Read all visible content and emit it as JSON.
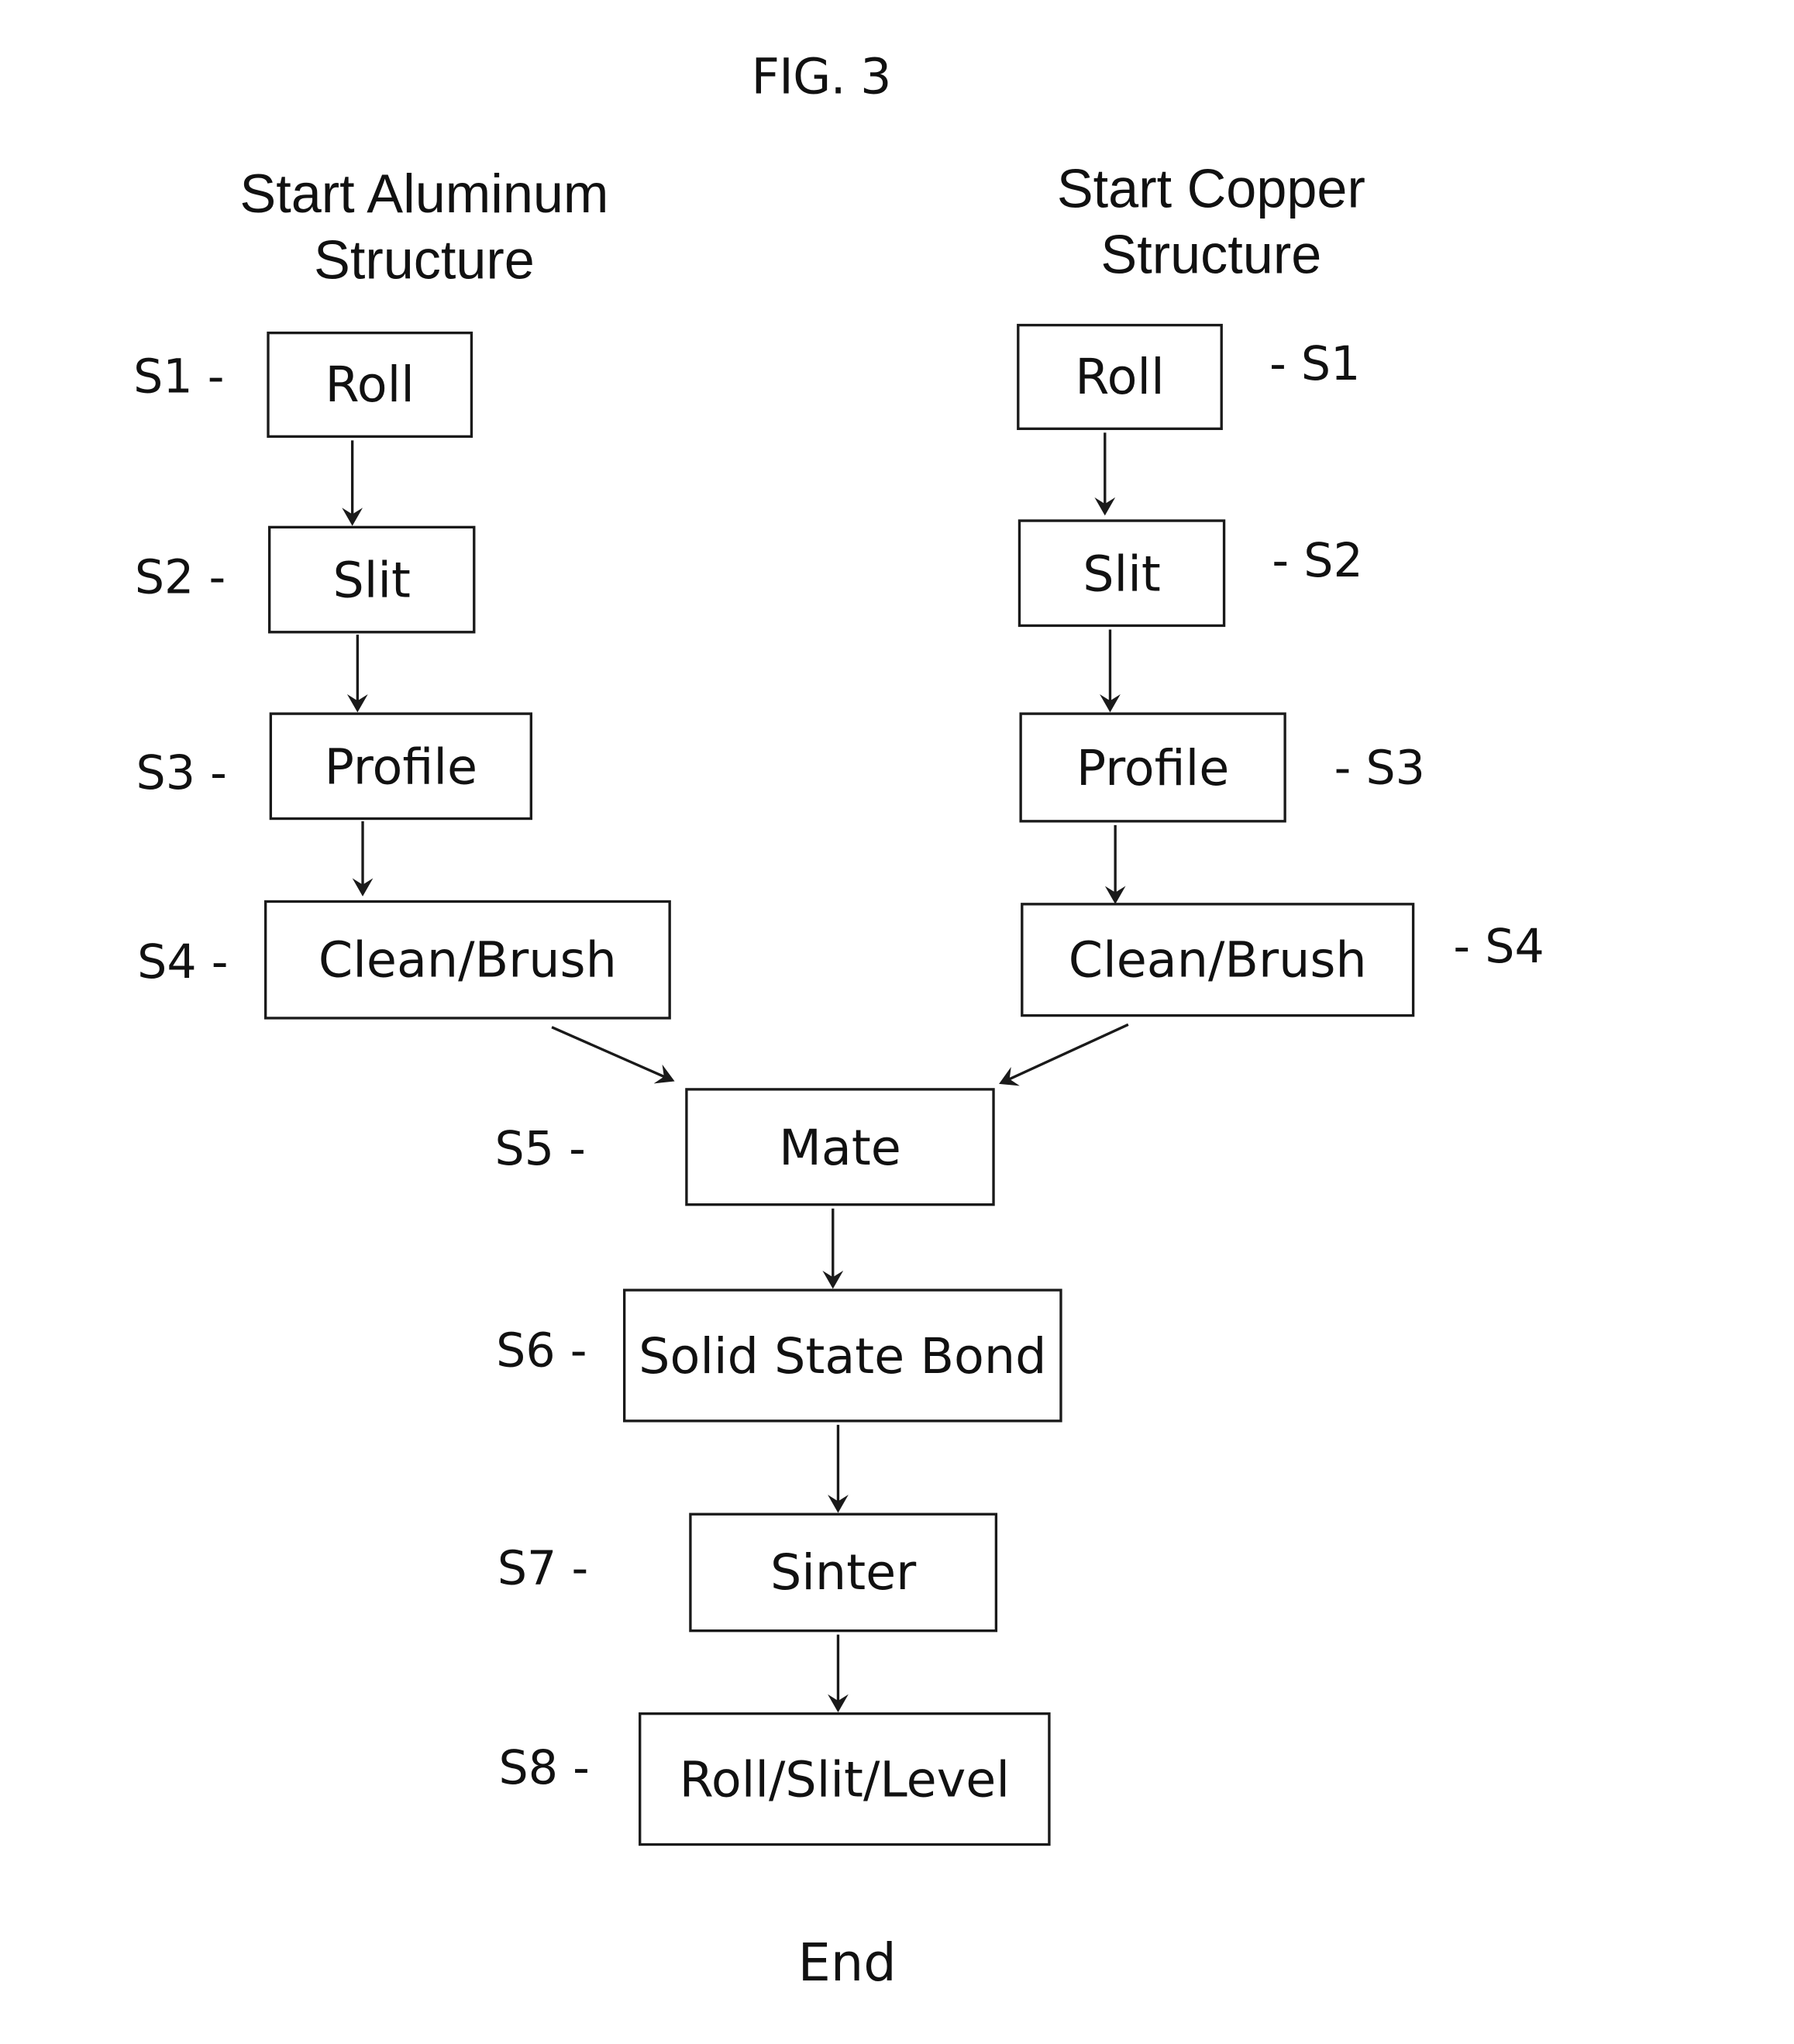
{
  "figure": {
    "title": "FIG. 3",
    "end_label": "End"
  },
  "columns": {
    "aluminum": {
      "title_line1": "Start Aluminum",
      "title_line2": "Structure",
      "steps": [
        {
          "id": "S1",
          "label": "S1 -",
          "text": "Roll"
        },
        {
          "id": "S2",
          "label": "S2 -",
          "text": "Slit"
        },
        {
          "id": "S3",
          "label": "S3 -",
          "text": "Profile"
        },
        {
          "id": "S4",
          "label": "S4 -",
          "text": "Clean/Brush"
        }
      ]
    },
    "copper": {
      "title_line1": "Start Copper",
      "title_line2": "Structure",
      "steps": [
        {
          "id": "S1",
          "label": "- S1",
          "text": "Roll"
        },
        {
          "id": "S2",
          "label": "- S2",
          "text": "Slit"
        },
        {
          "id": "S3",
          "label": "- S3",
          "text": "Profile"
        },
        {
          "id": "S4",
          "label": "- S4",
          "text": "Clean/Brush"
        }
      ]
    }
  },
  "merged_steps": [
    {
      "id": "S5",
      "label": "S5 -",
      "text": "Mate"
    },
    {
      "id": "S6",
      "label": "S6 -",
      "text": "Solid State Bond"
    },
    {
      "id": "S7",
      "label": "S7 -",
      "text": "Sinter"
    },
    {
      "id": "S8",
      "label": "S8 -",
      "text": "Roll/Slit/Level"
    }
  ],
  "connections": [
    {
      "from": "Al-S1",
      "to": "Al-S2"
    },
    {
      "from": "Al-S2",
      "to": "Al-S3"
    },
    {
      "from": "Al-S3",
      "to": "Al-S4"
    },
    {
      "from": "Al-S4",
      "to": "S5"
    },
    {
      "from": "Cu-S1",
      "to": "Cu-S2"
    },
    {
      "from": "Cu-S2",
      "to": "Cu-S3"
    },
    {
      "from": "Cu-S3",
      "to": "Cu-S4"
    },
    {
      "from": "Cu-S4",
      "to": "S5"
    },
    {
      "from": "S5",
      "to": "S6"
    },
    {
      "from": "S6",
      "to": "S7"
    },
    {
      "from": "S7",
      "to": "S8"
    }
  ]
}
